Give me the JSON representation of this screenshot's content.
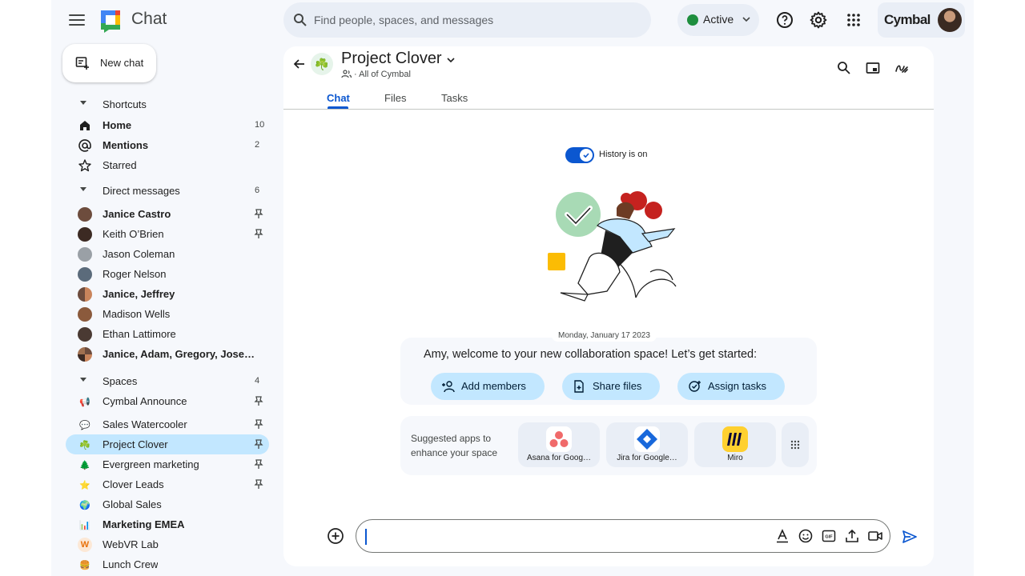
{
  "app": {
    "title": "Chat",
    "brand": "Cymbal"
  },
  "search": {
    "placeholder": "Find people, spaces, and messages"
  },
  "status": {
    "label": "Active",
    "color": "#1e8e3e"
  },
  "new_chat": {
    "label": "New chat"
  },
  "sidebar": {
    "shortcuts": {
      "label": "Shortcuts",
      "items": [
        {
          "label": "Home",
          "count": "10",
          "icon": "home-icon",
          "bold": true
        },
        {
          "label": "Mentions",
          "count": "2",
          "icon": "at-icon",
          "bold": true
        },
        {
          "label": "Starred",
          "count": "",
          "icon": "star-icon",
          "bold": false
        }
      ]
    },
    "direct_messages": {
      "label": "Direct messages",
      "count": "6",
      "items": [
        {
          "label": "Janice Castro",
          "bold": true,
          "pinned": true
        },
        {
          "label": "Keith O’Brien",
          "bold": false,
          "pinned": true
        },
        {
          "label": "Jason Coleman",
          "bold": false,
          "pinned": false
        },
        {
          "label": "Roger Nelson",
          "bold": false,
          "pinned": false
        },
        {
          "label": "Janice, Jeffrey",
          "bold": true,
          "pinned": false
        },
        {
          "label": "Madison Wells",
          "bold": false,
          "pinned": false
        },
        {
          "label": "Ethan Lattimore",
          "bold": false,
          "pinned": false
        },
        {
          "label": "Janice, Adam, Gregory, Jose…",
          "bold": true,
          "pinned": false
        }
      ]
    },
    "spaces": {
      "label": "Spaces",
      "count": "4",
      "items": [
        {
          "label": "Cymbal Announce",
          "bold": false,
          "pinned": true,
          "emoji": "📢"
        },
        {
          "label": "Sales Watercooler",
          "bold": false,
          "pinned": true,
          "emoji": "💬"
        },
        {
          "label": "Project Clover",
          "bold": false,
          "pinned": true,
          "emoji": "☘️",
          "selected": true
        },
        {
          "label": "Evergreen marketing",
          "bold": false,
          "pinned": true,
          "emoji": "🌲"
        },
        {
          "label": "Clover Leads",
          "bold": false,
          "pinned": true,
          "emoji": "⭐"
        },
        {
          "label": "Global Sales",
          "bold": false,
          "pinned": false,
          "emoji": "🌍"
        },
        {
          "label": "Marketing EMEA",
          "bold": true,
          "pinned": false,
          "emoji": "📊"
        },
        {
          "label": "WebVR Lab",
          "bold": false,
          "pinned": false,
          "emoji": "W"
        },
        {
          "label": "Lunch Crew",
          "bold": false,
          "pinned": false,
          "emoji": "🍔"
        }
      ]
    }
  },
  "space": {
    "title": "Project Clover",
    "subtitle": "· All of Cymbal",
    "icon": "☘️",
    "tabs": [
      "Chat",
      "Files",
      "Tasks"
    ],
    "active_tab": "Chat"
  },
  "history": {
    "label": "History is on",
    "on": true
  },
  "date": "Monday, January 17 2023",
  "welcome": {
    "text": "Amy, welcome to your new collaboration space! Let’s get started:",
    "actions": [
      "Add members",
      "Share files",
      "Assign tasks"
    ]
  },
  "suggested": {
    "text": "Suggested apps to enhance your space",
    "apps": [
      "Asana for Goog…",
      "Jira for Google…",
      "Miro"
    ]
  },
  "compose": {
    "value": ""
  },
  "colors": {
    "accent": "#0b57d0",
    "selected": "#c2e7ff",
    "surface": "#f6f8fc"
  }
}
